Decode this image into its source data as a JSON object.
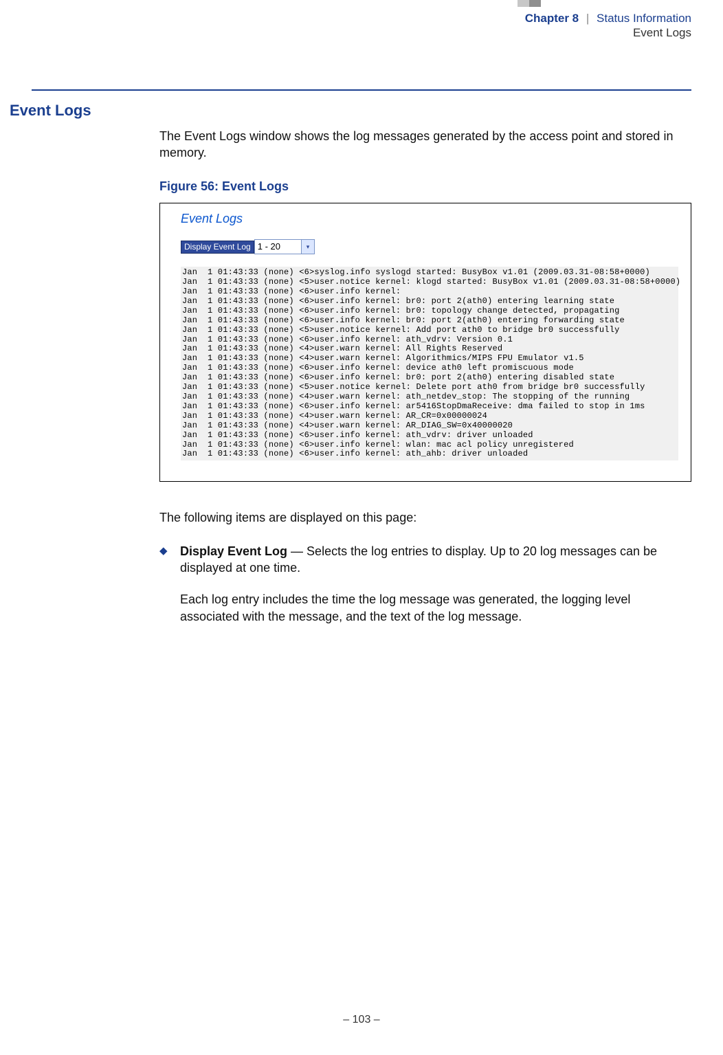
{
  "header": {
    "chapter_label": "Chapter 8",
    "separator": "|",
    "chapter_title": "Status Information",
    "section_title": "Event Logs"
  },
  "side_heading": "Event Logs",
  "intro_paragraph": "The Event Logs window shows the log messages generated by the access point and stored in memory.",
  "figure": {
    "caption": "Figure 56:  Event Logs",
    "panel_title": "Event Logs",
    "display_button_label": "Display Event Log",
    "range_value": "1 - 20",
    "log_lines": [
      "Jan  1 01:43:33 (none) <6>syslog.info syslogd started: BusyBox v1.01 (2009.03.31-08:58+0000)",
      "Jan  1 01:43:33 (none) <5>user.notice kernel: klogd started: BusyBox v1.01 (2009.03.31-08:58+0000)",
      "Jan  1 01:43:33 (none) <6>user.info kernel:",
      "Jan  1 01:43:33 (none) <6>user.info kernel: br0: port 2(ath0) entering learning state",
      "Jan  1 01:43:33 (none) <6>user.info kernel: br0: topology change detected, propagating",
      "Jan  1 01:43:33 (none) <6>user.info kernel: br0: port 2(ath0) entering forwarding state",
      "Jan  1 01:43:33 (none) <5>user.notice kernel: Add port ath0 to bridge br0 successfully",
      "Jan  1 01:43:33 (none) <6>user.info kernel: ath_vdrv: Version 0.1",
      "Jan  1 01:43:33 (none) <4>user.warn kernel: All Rights Reserved",
      "Jan  1 01:43:33 (none) <4>user.warn kernel: Algorithmics/MIPS FPU Emulator v1.5",
      "Jan  1 01:43:33 (none) <6>user.info kernel: device ath0 left promiscuous mode",
      "Jan  1 01:43:33 (none) <6>user.info kernel: br0: port 2(ath0) entering disabled state",
      "Jan  1 01:43:33 (none) <5>user.notice kernel: Delete port ath0 from bridge br0 successfully",
      "Jan  1 01:43:33 (none) <4>user.warn kernel: ath_netdev_stop: The stopping of the running",
      "Jan  1 01:43:33 (none) <6>user.info kernel: ar5416StopDmaReceive: dma failed to stop in 1ms",
      "Jan  1 01:43:33 (none) <4>user.warn kernel: AR_CR=0x00000024",
      "Jan  1 01:43:33 (none) <4>user.warn kernel: AR_DIAG_SW=0x40000020",
      "Jan  1 01:43:33 (none) <6>user.info kernel: ath_vdrv: driver unloaded",
      "Jan  1 01:43:33 (none) <6>user.info kernel: wlan: mac acl policy unregistered",
      "Jan  1 01:43:33 (none) <6>user.info kernel: ath_ahb: driver unloaded"
    ]
  },
  "body": {
    "lead_in": "The following items are displayed on this page:",
    "bullets": [
      {
        "term": "Display Event Log",
        "desc": " — Selects the log entries to display. Up to 20 log messages can be displayed at one time.",
        "sub": "Each log entry includes the time the log message was generated, the logging level associated with the message, and the text of the log message."
      }
    ]
  },
  "footer": "–  103  –"
}
